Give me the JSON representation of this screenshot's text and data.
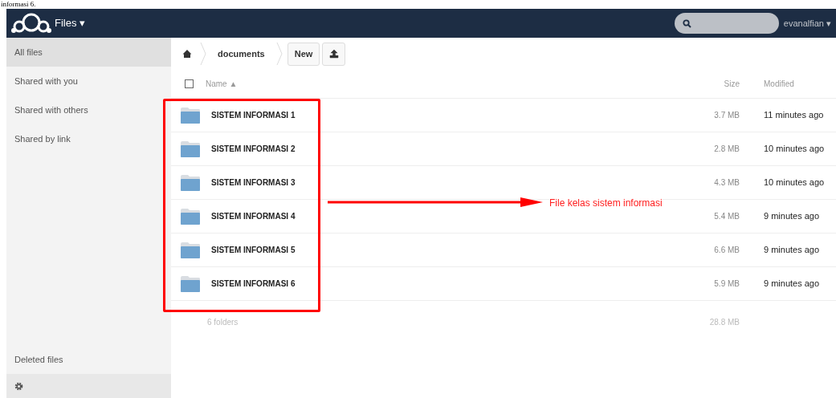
{
  "caption": "informasi 6.",
  "header": {
    "app_title": "Files ▾",
    "user": "evanalfian ▾"
  },
  "sidebar": {
    "items": [
      {
        "label": "All files",
        "selected": true
      },
      {
        "label": "Shared with you",
        "selected": false
      },
      {
        "label": "Shared with others",
        "selected": false
      },
      {
        "label": "Shared by link",
        "selected": false
      }
    ],
    "footer_items": [
      "Deleted files"
    ]
  },
  "breadcrumb": [
    "documents"
  ],
  "toolbar": {
    "new_button": "New"
  },
  "table": {
    "select_all": {
      "checked": false
    },
    "columns": [
      "Name ▲",
      "Size",
      "Modified"
    ],
    "rows": [
      {
        "name": "SISTEM INFORMASI 1",
        "size": "3.7 MB",
        "modified": "11 minutes ago"
      },
      {
        "name": "SISTEM INFORMASI 2",
        "size": "2.8 MB",
        "modified": "10 minutes ago"
      },
      {
        "name": "SISTEM INFORMASI 3",
        "size": "4.3 MB",
        "modified": "10 minutes ago"
      },
      {
        "name": "SISTEM INFORMASI 4",
        "size": "5.4 MB",
        "modified": "9 minutes ago"
      },
      {
        "name": "SISTEM INFORMASI 5",
        "size": "6.6 MB",
        "modified": "9 minutes ago"
      },
      {
        "name": "SISTEM INFORMASI 6",
        "size": "5.9 MB",
        "modified": "9 minutes ago"
      }
    ],
    "summary": {
      "count": "6 folders",
      "size": "28.8 MB"
    }
  },
  "annotation": {
    "label": "File kelas sistem informasi"
  }
}
